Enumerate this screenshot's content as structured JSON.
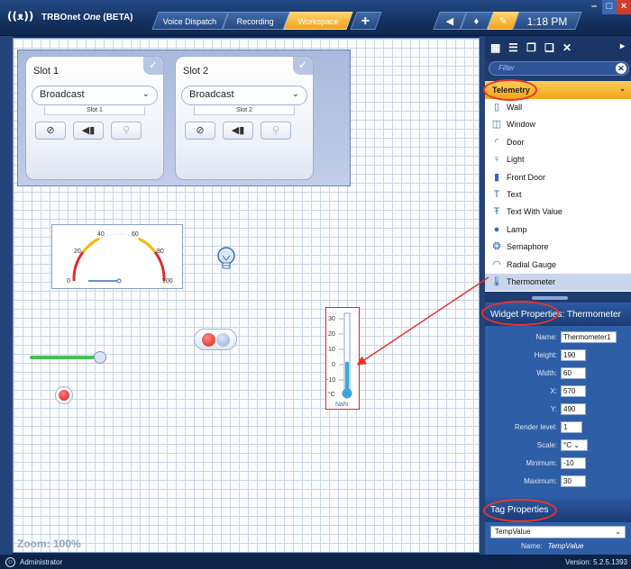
{
  "app": {
    "title_prefix": "TRBOnet",
    "title_italic": "One",
    "title_suffix": "(BETA)",
    "tabs": [
      "Voice Dispatch",
      "Recording",
      "Workspace"
    ],
    "add_tab": "+",
    "time": "1:18 PM"
  },
  "slots": [
    {
      "title": "Slot 1",
      "mode": "Broadcast",
      "sub": "Slot 1"
    },
    {
      "title": "Slot 2",
      "mode": "Broadcast",
      "sub": "Slot 2"
    }
  ],
  "gauge": {
    "ticks": [
      "0",
      "20",
      "40",
      "60",
      "80",
      "100"
    ]
  },
  "thermometer": {
    "ticks": [
      "30",
      "20",
      "10",
      "0",
      "-10"
    ],
    "unit": "°C",
    "value": "NaN"
  },
  "workspace": {
    "zoom": "Zoom: 100%"
  },
  "panel": {
    "filter_placeholder": "Filter",
    "category": "Telemetry",
    "widgets": [
      {
        "label": "Wall",
        "icon": "wall-icon"
      },
      {
        "label": "Window",
        "icon": "window-icon"
      },
      {
        "label": "Door",
        "icon": "door-icon"
      },
      {
        "label": "Light",
        "icon": "light-icon"
      },
      {
        "label": "Front Door",
        "icon": "front-door-icon"
      },
      {
        "label": "Text",
        "icon": "text-icon"
      },
      {
        "label": "Text With Value",
        "icon": "text-with-value-icon"
      },
      {
        "label": "Lamp",
        "icon": "lamp-icon"
      },
      {
        "label": "Semaphore",
        "icon": "semaphore-icon"
      },
      {
        "label": "Radial Gauge",
        "icon": "radial-gauge-icon"
      },
      {
        "label": "Thermometer",
        "icon": "thermometer-icon"
      }
    ],
    "widget_properties_title": "Widget Properties:",
    "widget_properties_name": "Thermometer",
    "properties": [
      {
        "label": "Name:",
        "value": "Thermometer1"
      },
      {
        "label": "Height:",
        "value": "190"
      },
      {
        "label": "Width:",
        "value": "60"
      },
      {
        "label": "X:",
        "value": "570"
      },
      {
        "label": "Y:",
        "value": "490"
      },
      {
        "label": "Render level:",
        "value": "1"
      },
      {
        "label": "Scale:",
        "value": "°C"
      },
      {
        "label": "Minimum:",
        "value": "-10"
      },
      {
        "label": "Maximum:",
        "value": "30"
      }
    ],
    "tag_properties_title": "Tag Properties",
    "tag_value": "TempValue",
    "tag_name_label": "Name:",
    "tag_name_value": "TempValue"
  },
  "status": {
    "user": "Administrator",
    "version": "Version: 5.2.5.1393"
  },
  "colors": {
    "accent": "#f2a21a",
    "annotation": "#e8342a",
    "panel": "#2e5ea6"
  }
}
